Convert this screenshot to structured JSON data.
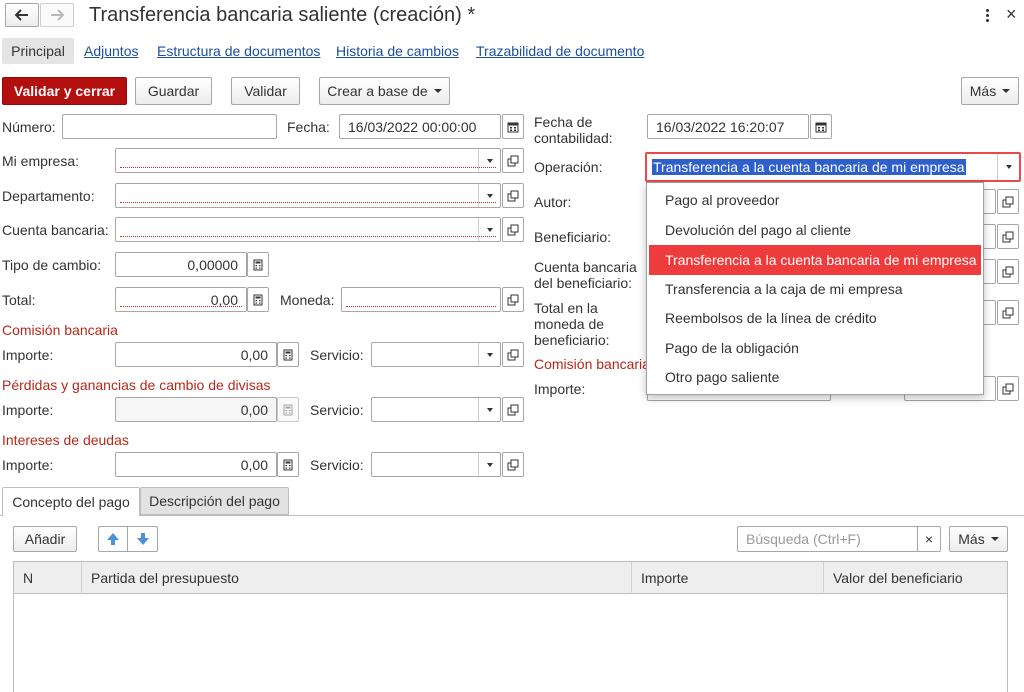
{
  "window": {
    "title": "Transferencia bancaria saliente (creación) *"
  },
  "nav_tabs": [
    "Principal",
    "Adjuntos",
    "Estructura de documentos",
    "Historia de cambios",
    "Trazabilidad de documento"
  ],
  "toolbar": {
    "validate_close": "Validar y cerrar",
    "save": "Guardar",
    "validate": "Validar",
    "create_based": "Crear a base de",
    "more": "Más"
  },
  "form": {
    "numero": {
      "label": "Número:",
      "value": ""
    },
    "fecha": {
      "label": "Fecha:",
      "value": "16/03/2022 00:00:00"
    },
    "fecha_contab": {
      "label": "Fecha de contabilidad:",
      "value": "16/03/2022 16:20:07"
    },
    "mi_empresa": {
      "label": "Mi empresa:",
      "value": ""
    },
    "operacion": {
      "label": "Operación:",
      "value": "Transferencia a la cuenta bancaria de mi empresa"
    },
    "departamento": {
      "label": "Departamento:",
      "value": ""
    },
    "autor": {
      "label": "Autor:"
    },
    "cuenta_bancaria": {
      "label": "Cuenta bancaria:",
      "value": ""
    },
    "beneficiario": {
      "label": "Beneficiario:"
    },
    "tipo_cambio": {
      "label": "Tipo de cambio:",
      "value": "0,00000"
    },
    "cuenta_benef": {
      "label": "Cuenta bancaria del beneficiario:"
    },
    "total": {
      "label": "Total:",
      "value": "0,00"
    },
    "moneda": {
      "label": "Moneda:",
      "value": ""
    },
    "total_moneda_benef": {
      "label": "Total en la moneda de beneficiario:"
    },
    "comision_title": "Comisión bancaria",
    "comision_right_title": "Comisión bancaria",
    "importe_label": "Importe:",
    "servicio_label": "Servicio:",
    "comision_importe": "0,00",
    "perdidas_title": "Pérdidas y ganancias de cambio de divisas",
    "perdidas_importe": "0,00",
    "intereses_title": "Intereses de deudas",
    "intereses_importe": "0,00"
  },
  "dropdown": {
    "options": [
      "Pago al proveedor",
      "Devolución del pago al cliente",
      "Transferencia a la cuenta bancaria de mi empresa",
      "Transferencia a la caja de mi empresa",
      "Reembolsos de la línea de crédito",
      "Pago de la obligación",
      "Otro pago saliente"
    ],
    "selected_index": 2
  },
  "bottom_tabs": [
    "Concepto del pago",
    "Descripción del pago"
  ],
  "table_toolbar": {
    "add": "Añadir",
    "search_placeholder": "Búsqueda (Ctrl+F)",
    "more": "Más"
  },
  "table": {
    "columns": [
      "N",
      "Partida del presupuesto",
      "Importe",
      "Valor del beneficiario"
    ]
  },
  "colors": {
    "primary": "#b30f0f",
    "section": "#b5291b",
    "link": "#1a4f9c",
    "selection": "#ee3b3b"
  }
}
